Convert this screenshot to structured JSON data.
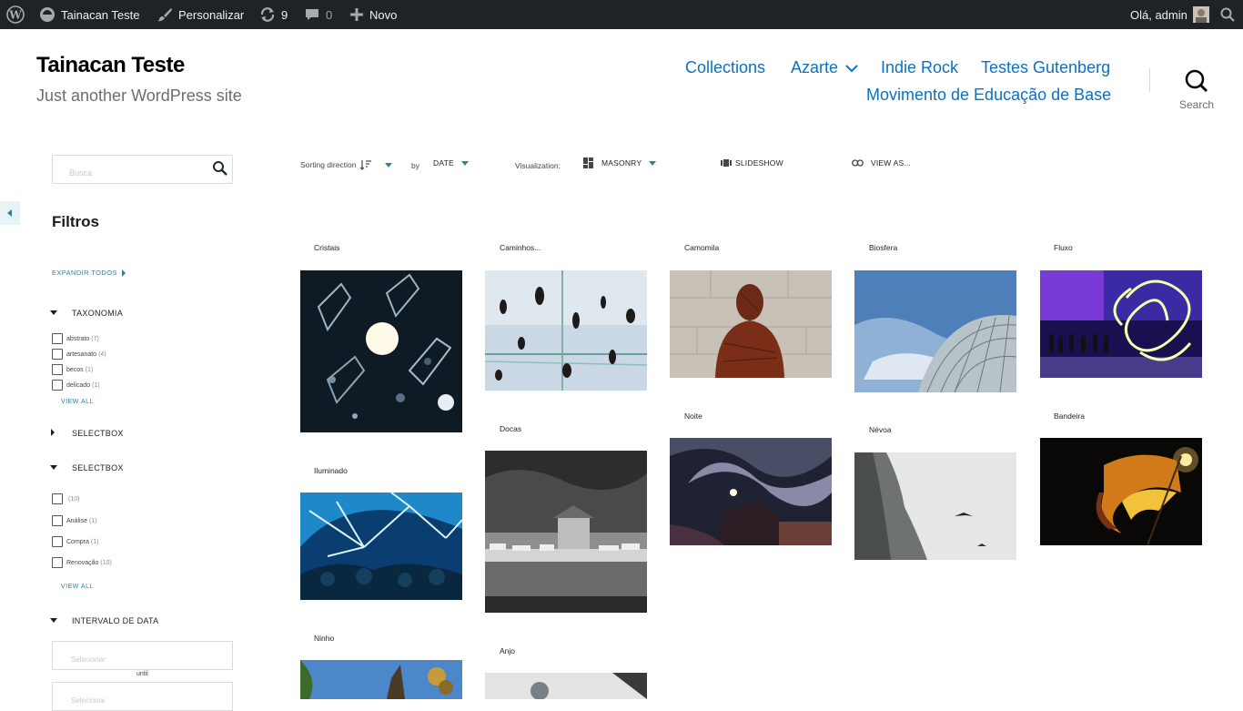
{
  "admin_bar": {
    "site_name": "Tainacan Teste",
    "customize": "Personalizar",
    "updates_count": "9",
    "comments_count": "0",
    "new_label": "Novo",
    "greeting": "Olá, admin"
  },
  "header": {
    "site_title": "Tainacan Teste",
    "site_description": "Just another WordPress site",
    "nav": [
      "Collections",
      "Azarte",
      "Indie Rock",
      "Testes Gutenberg",
      "Movimento de Educação de Base"
    ],
    "search_label": "Search"
  },
  "sidebar": {
    "search_placeholder": "Busca",
    "filters_title": "Filtros",
    "expand_all": "EXPANDIR TODOS",
    "taxonomy": {
      "label": "TAXONOMIA",
      "options": [
        {
          "label": "abstrato",
          "count": "(7)"
        },
        {
          "label": "artesanato",
          "count": "(4)"
        },
        {
          "label": "becos",
          "count": "(1)"
        },
        {
          "label": "delicado",
          "count": "(1)"
        }
      ],
      "view_all": "VIEW ALL"
    },
    "selectbox_collapsed": {
      "label": "SELECTBOX"
    },
    "selectbox": {
      "label": "SELECTBOX",
      "options": [
        {
          "label": "",
          "count": "(10)"
        },
        {
          "label": "Análise",
          "count": "(1)"
        },
        {
          "label": "Compra",
          "count": "(1)"
        },
        {
          "label": "Renovação",
          "count": "(10)"
        }
      ],
      "view_all": "VIEW ALL"
    },
    "date_range": {
      "label": "INTERVALO DE DATA",
      "from_placeholder": "Selecionar",
      "until": "until",
      "to_placeholder": "Selecionar"
    }
  },
  "toolbar": {
    "sorting_direction": "Sorting direction",
    "by": "by",
    "sort_field": "DATE",
    "visualization": "Visualization:",
    "view_mode": "MASONRY",
    "slideshow": "SLIDESHOW",
    "view_as": "VIEW AS..."
  },
  "items": [
    {
      "title": "Cristais"
    },
    {
      "title": "Caminhos..."
    },
    {
      "title": "Camomila"
    },
    {
      "title": "Biosfera"
    },
    {
      "title": "Fluxo"
    },
    {
      "title": "Iluminado"
    },
    {
      "title": "Docas"
    },
    {
      "title": "Noite"
    },
    {
      "title": "Névoa"
    },
    {
      "title": "Bandeira"
    },
    {
      "title": "Ninho"
    },
    {
      "title": "Anjo"
    }
  ],
  "colors": {
    "admin_bar_bg": "#1d2327",
    "link_blue": "#0c71c3",
    "accent_teal": "#298596"
  }
}
